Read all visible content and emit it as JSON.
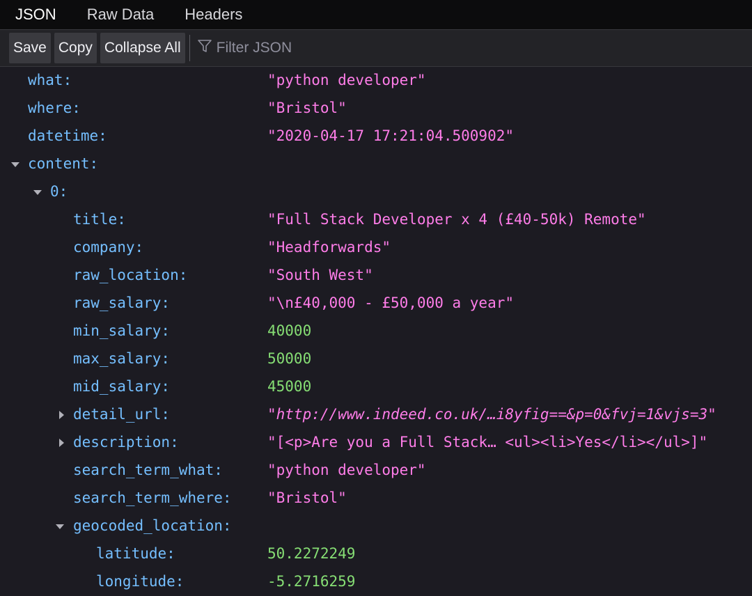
{
  "tabs": [
    {
      "label": "JSON"
    },
    {
      "label": "Raw Data"
    },
    {
      "label": "Headers"
    }
  ],
  "toolbar": {
    "save_label": "Save",
    "copy_label": "Copy",
    "collapse_label": "Collapse All",
    "filter_placeholder": "Filter JSON"
  },
  "colors": {
    "background": "#1c1b22",
    "key": "#75bfff",
    "string": "#ff7de9",
    "number": "#86de74"
  },
  "rows": [
    {
      "key": "what:",
      "value": "\"python developer\""
    },
    {
      "key": "where:",
      "value": "\"Bristol\""
    },
    {
      "key": "datetime:",
      "value": "\"2020-04-17 17:21:04.500902\""
    },
    {
      "key": "content:",
      "value": ""
    },
    {
      "key": "0:",
      "value": ""
    },
    {
      "key": "title:",
      "value": "\"Full Stack Developer x 4 (£40-50k) Remote\""
    },
    {
      "key": "company:",
      "value": "\"Headforwards\""
    },
    {
      "key": "raw_location:",
      "value": "\"South West\""
    },
    {
      "key": "raw_salary:",
      "value": "\"\\n£40,000 - £50,000 a year\""
    },
    {
      "key": "min_salary:",
      "value": "40000"
    },
    {
      "key": "max_salary:",
      "value": "50000"
    },
    {
      "key": "mid_salary:",
      "value": "45000"
    },
    {
      "key": "detail_url:",
      "value": "\"http://www.indeed.co.uk/…i8yfig==&p=0&fvj=1&vjs=3\""
    },
    {
      "key": "description:",
      "value": "\"[<p>Are you a Full Stack… <ul><li>Yes</li></ul>]\""
    },
    {
      "key": "search_term_what:",
      "value": "\"python developer\""
    },
    {
      "key": "search_term_where:",
      "value": "\"Bristol\""
    },
    {
      "key": "geocoded_location:",
      "value": ""
    },
    {
      "key": "latitude:",
      "value": "50.2272249"
    },
    {
      "key": "longitude:",
      "value": "-5.2716259"
    }
  ]
}
